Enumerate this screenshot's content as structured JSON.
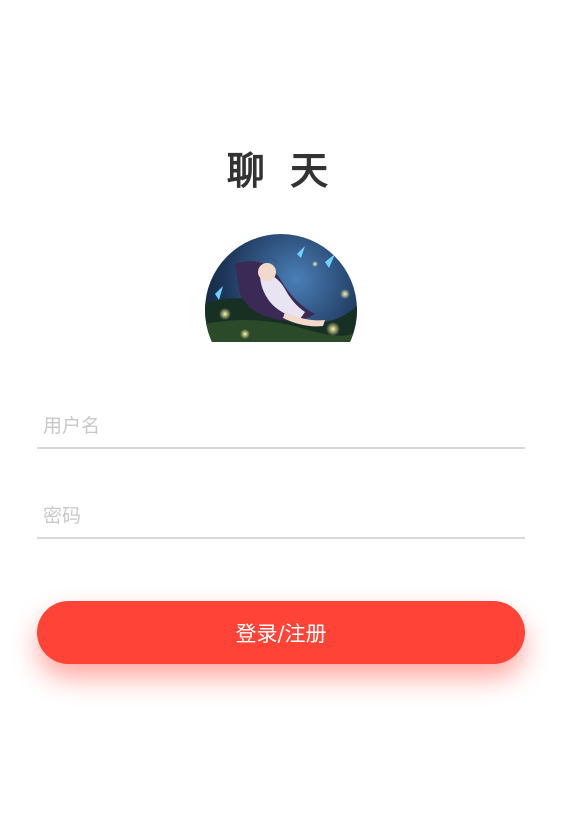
{
  "header": {
    "title": "聊 天"
  },
  "avatar": {
    "image": "anime-character-illustration"
  },
  "form": {
    "username_placeholder": "用户名",
    "username_value": "",
    "password_placeholder": "密码",
    "password_value": ""
  },
  "actions": {
    "login_register_label": "登录/注册"
  },
  "colors": {
    "accent": "#ff4336",
    "title_text": "#333333",
    "placeholder": "#c8c8c8",
    "underline": "#d9d9d9"
  }
}
